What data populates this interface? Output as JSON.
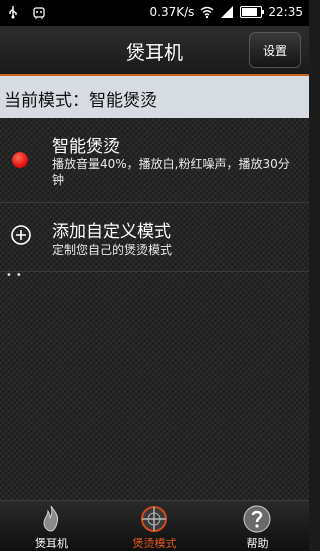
{
  "status_bar": {
    "speed": "0.37K/s",
    "time": "22:35",
    "battery_level": 0.85
  },
  "header": {
    "title": "煲耳机",
    "settings_label": "设置",
    "accent_color": "#c9631c"
  },
  "current_mode": {
    "text": "当前模式：智能煲烫"
  },
  "modes": [
    {
      "title": "智能煲烫",
      "description": "播放音量40%，播放白,粉红噪声，播放30分钟",
      "icon": "red-dot-icon",
      "color": "#e4140e"
    },
    {
      "title": "添加自定义模式",
      "description": "定制您自己的煲烫模式",
      "icon": "plus-circle-icon"
    }
  ],
  "bottom_nav": [
    {
      "label": "煲耳机",
      "icon": "flame-icon",
      "active": false
    },
    {
      "label": "煲烫模式",
      "icon": "crosshair-globe-icon",
      "active": true
    },
    {
      "label": "帮助",
      "icon": "help-icon",
      "active": false
    }
  ],
  "active_color": "#e35a1d"
}
